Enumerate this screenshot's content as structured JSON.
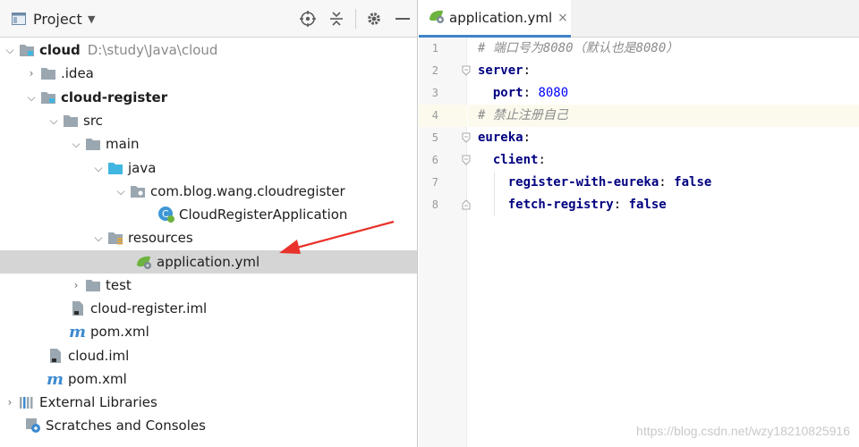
{
  "project_panel": {
    "title": "Project",
    "icon": "project-window-icon",
    "buttons": {
      "locate": "target-icon",
      "collapse": "collapse-all-icon",
      "settings": "gear-icon",
      "hide": "minimize-icon"
    }
  },
  "tree": [
    {
      "label": "cloud",
      "hint": "D:\\study\\Java\\cloud",
      "bold": true,
      "expanded": true,
      "icon": "module-folder-icon"
    },
    {
      "label": ".idea",
      "expanded": false,
      "icon": "folder-icon"
    },
    {
      "label": "cloud-register",
      "bold": true,
      "expanded": true,
      "icon": "module-folder-icon"
    },
    {
      "label": "src",
      "expanded": true,
      "icon": "folder-icon"
    },
    {
      "label": "main",
      "expanded": true,
      "icon": "folder-icon"
    },
    {
      "label": "java",
      "expanded": true,
      "icon": "source-folder-icon"
    },
    {
      "label": "com.blog.wang.cloudregister",
      "expanded": true,
      "icon": "package-icon"
    },
    {
      "label": "CloudRegisterApplication",
      "icon": "spring-boot-class-icon"
    },
    {
      "label": "resources",
      "expanded": true,
      "icon": "resources-folder-icon"
    },
    {
      "label": "application.yml",
      "icon": "spring-yaml-file-icon",
      "selected": true
    },
    {
      "label": "test",
      "expanded": false,
      "icon": "folder-icon"
    },
    {
      "label": "cloud-register.iml",
      "icon": "iml-file-icon"
    },
    {
      "label": "pom.xml",
      "icon": "maven-icon"
    },
    {
      "label": "cloud.iml",
      "icon": "iml-file-icon"
    },
    {
      "label": "pom.xml",
      "icon": "maven-icon"
    },
    {
      "label": "External Libraries",
      "expanded": false,
      "icon": "libraries-icon"
    },
    {
      "label": "Scratches and Consoles",
      "icon": "scratches-icon"
    }
  ],
  "editor": {
    "tab": {
      "label": "application.yml",
      "icon": "spring-yaml-file-icon",
      "close": "×"
    },
    "current_line": 4,
    "line_numbers": [
      "1",
      "2",
      "3",
      "4",
      "5",
      "6",
      "7",
      "8"
    ],
    "lines": [
      {
        "comment": "# 端口号为8080（默认也是8080）"
      },
      {
        "key": "server",
        "punct": ":"
      },
      {
        "key": "port",
        "punct": ": ",
        "num": "8080"
      },
      {
        "comment": "# 禁止注册自己"
      },
      {
        "key": "eureka",
        "punct": ":"
      },
      {
        "key": "client",
        "punct": ":"
      },
      {
        "key": "register-with-eureka",
        "punct": ": ",
        "bool": "false"
      },
      {
        "key": "fetch-registry",
        "punct": ": ",
        "bool": "false"
      }
    ]
  },
  "watermark": "https://blog.csdn.net/wzy18210825916",
  "colors": {
    "selection": "#d5d5d5",
    "current_line": "#fcfaed",
    "tab_underline": "#4083c9",
    "yaml_key": "#000080",
    "number": "#0000ff",
    "comment": "#8c8c8c",
    "arrow": "#e8322b",
    "folder": "#9aa7b0",
    "source_folder": "#40b6e0",
    "spring": "#6db33f"
  }
}
